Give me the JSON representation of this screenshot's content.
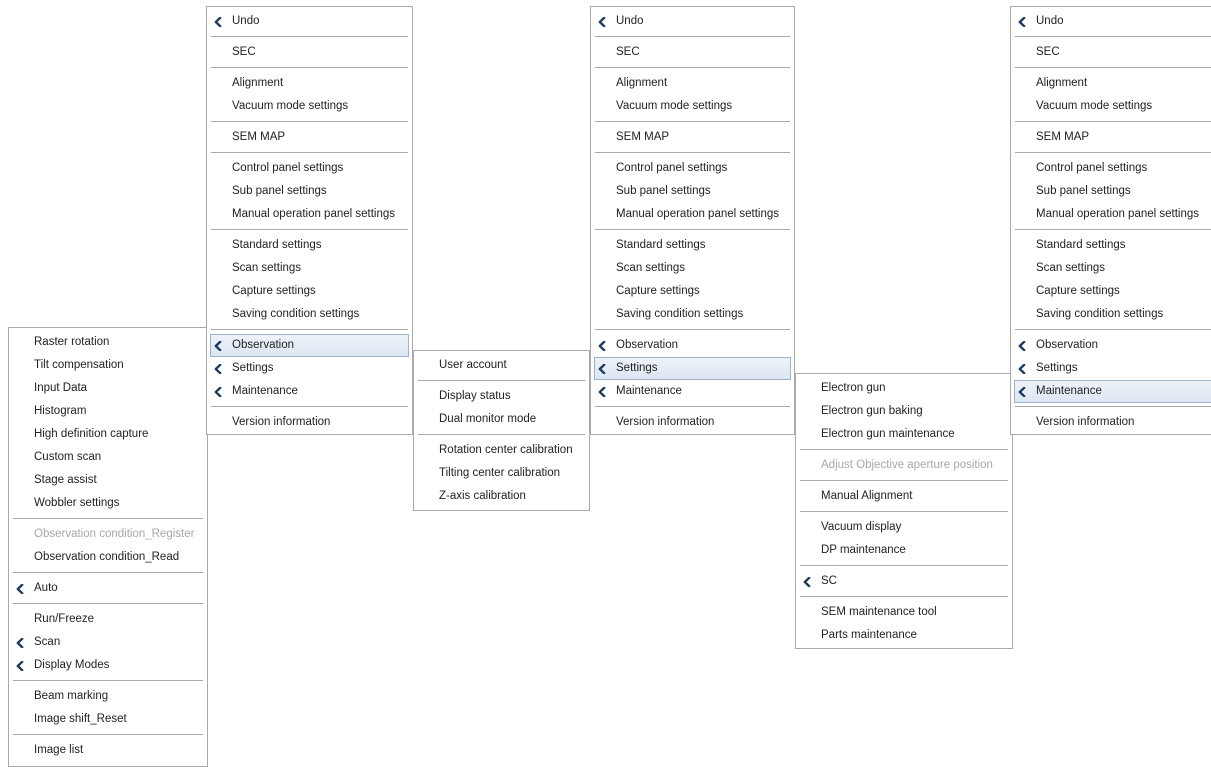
{
  "colors": {
    "selected_bg": "#dce6f2",
    "disabled_text": "#a8a8a8",
    "border": "#a9a9a9",
    "chevron": "#1f3b5e"
  },
  "observation_menu": {
    "groups": [
      [
        "Raster rotation",
        "Tilt compensation",
        "Input Data",
        "Histogram",
        "High definition capture",
        "Custom scan",
        "Stage assist",
        "Wobbler settings"
      ],
      [
        "Observation condition_Register",
        "Observation condition_Read"
      ],
      [
        "Auto"
      ],
      [
        "Run/Freeze",
        "Scan",
        "Display Modes"
      ],
      [
        "Beam marking",
        "Image shift_Reset"
      ],
      [
        "Image list"
      ]
    ],
    "submenu_items": [
      "Auto",
      "Scan",
      "Display Modes"
    ],
    "disabled_items": [
      "Observation condition_Register"
    ]
  },
  "main_menu_1": {
    "groups": [
      [
        "Undo"
      ],
      [
        "SEC"
      ],
      [
        "Alignment",
        "Vacuum mode settings"
      ],
      [
        "SEM MAP"
      ],
      [
        "Control panel settings",
        "Sub panel settings",
        "Manual operation panel settings"
      ],
      [
        "Standard settings",
        "Scan settings",
        "Capture settings",
        "Saving condition settings"
      ],
      [
        "Observation",
        "Settings",
        "Maintenance"
      ],
      [
        "Version information"
      ]
    ],
    "submenu_items": [
      "Undo",
      "Observation",
      "Settings",
      "Maintenance"
    ],
    "selected": "Observation"
  },
  "settings_menu": {
    "groups": [
      [
        "User account"
      ],
      [
        "Display status",
        "Dual monitor mode"
      ],
      [
        "Rotation center calibration",
        "Tilting center calibration",
        "Z-axis calibration"
      ]
    ],
    "submenu_items": []
  },
  "main_menu_2": {
    "groups": [
      [
        "Undo"
      ],
      [
        "SEC"
      ],
      [
        "Alignment",
        "Vacuum mode settings"
      ],
      [
        "SEM MAP"
      ],
      [
        "Control panel settings",
        "Sub panel settings",
        "Manual operation panel settings"
      ],
      [
        "Standard settings",
        "Scan settings",
        "Capture settings",
        "Saving condition settings"
      ],
      [
        "Observation",
        "Settings",
        "Maintenance"
      ],
      [
        "Version information"
      ]
    ],
    "submenu_items": [
      "Undo",
      "Observation",
      "Settings",
      "Maintenance"
    ],
    "selected": "Settings"
  },
  "maintenance_menu": {
    "groups": [
      [
        "Electron gun",
        "Electron gun baking",
        "Electron gun maintenance"
      ],
      [
        "Adjust Objective aperture position"
      ],
      [
        "Manual Alignment"
      ],
      [
        "Vacuum display",
        "DP maintenance"
      ],
      [
        "SC"
      ],
      [
        "SEM maintenance tool",
        "Parts maintenance"
      ]
    ],
    "submenu_items": [
      "SC"
    ],
    "disabled_items": [
      "Adjust Objective aperture position"
    ]
  },
  "main_menu_3": {
    "groups": [
      [
        "Undo"
      ],
      [
        "SEC"
      ],
      [
        "Alignment",
        "Vacuum mode settings"
      ],
      [
        "SEM MAP"
      ],
      [
        "Control panel settings",
        "Sub panel settings",
        "Manual operation panel settings"
      ],
      [
        "Standard settings",
        "Scan settings",
        "Capture settings",
        "Saving condition settings"
      ],
      [
        "Observation",
        "Settings",
        "Maintenance"
      ],
      [
        "Version information"
      ]
    ],
    "submenu_items": [
      "Undo",
      "Observation",
      "Settings",
      "Maintenance"
    ],
    "selected": "Maintenance"
  }
}
